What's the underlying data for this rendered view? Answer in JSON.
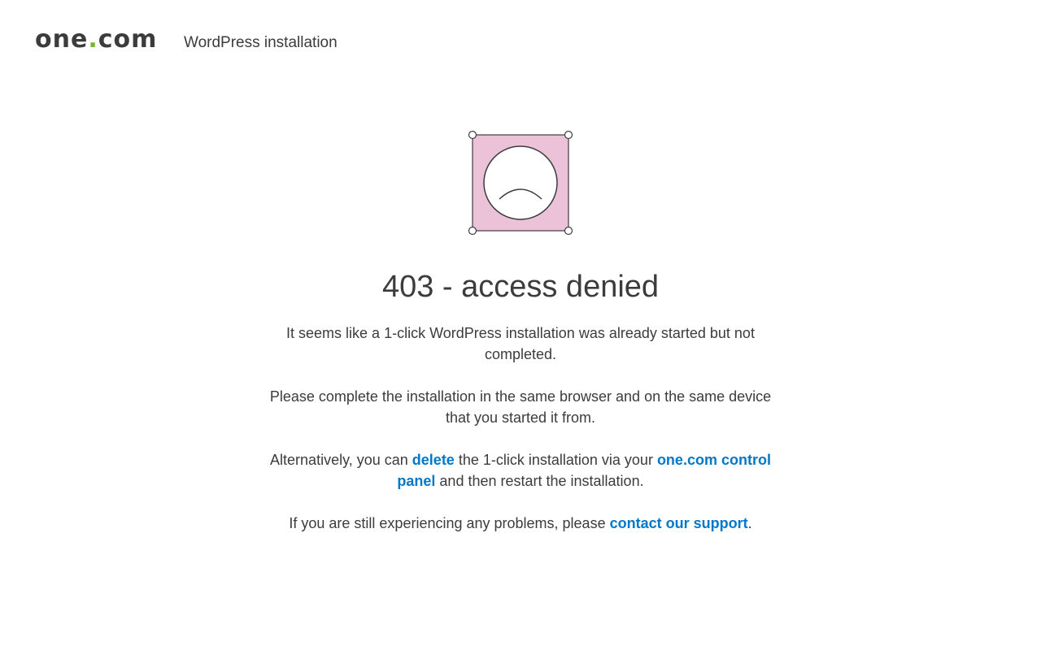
{
  "header": {
    "logo_text_left": "one",
    "logo_text_dot": ".",
    "logo_text_right": "com",
    "title": "WordPress installation"
  },
  "illustration": {
    "icon": "sad-face-icon",
    "fill_color": "#ecc2d8"
  },
  "main": {
    "heading": "403 - access denied",
    "para1": "It seems like a 1-click WordPress installation was already started but not completed.",
    "para2": "Please complete the installation in the same browser and on the same device that you started it from.",
    "para3": {
      "text_before": "Alternatively, you can ",
      "link_delete": "delete",
      "text_middle": " the 1-click installation via your ",
      "link_control_panel": "one.com control panel",
      "text_after": " and then restart the installation."
    },
    "para4": {
      "text_before": "If you are still experiencing any problems, please ",
      "link_support": "contact our support",
      "text_after": "."
    }
  },
  "colors": {
    "link": "#0078c8",
    "logo_dot": "#76b82a",
    "text": "#3c3c3c"
  }
}
